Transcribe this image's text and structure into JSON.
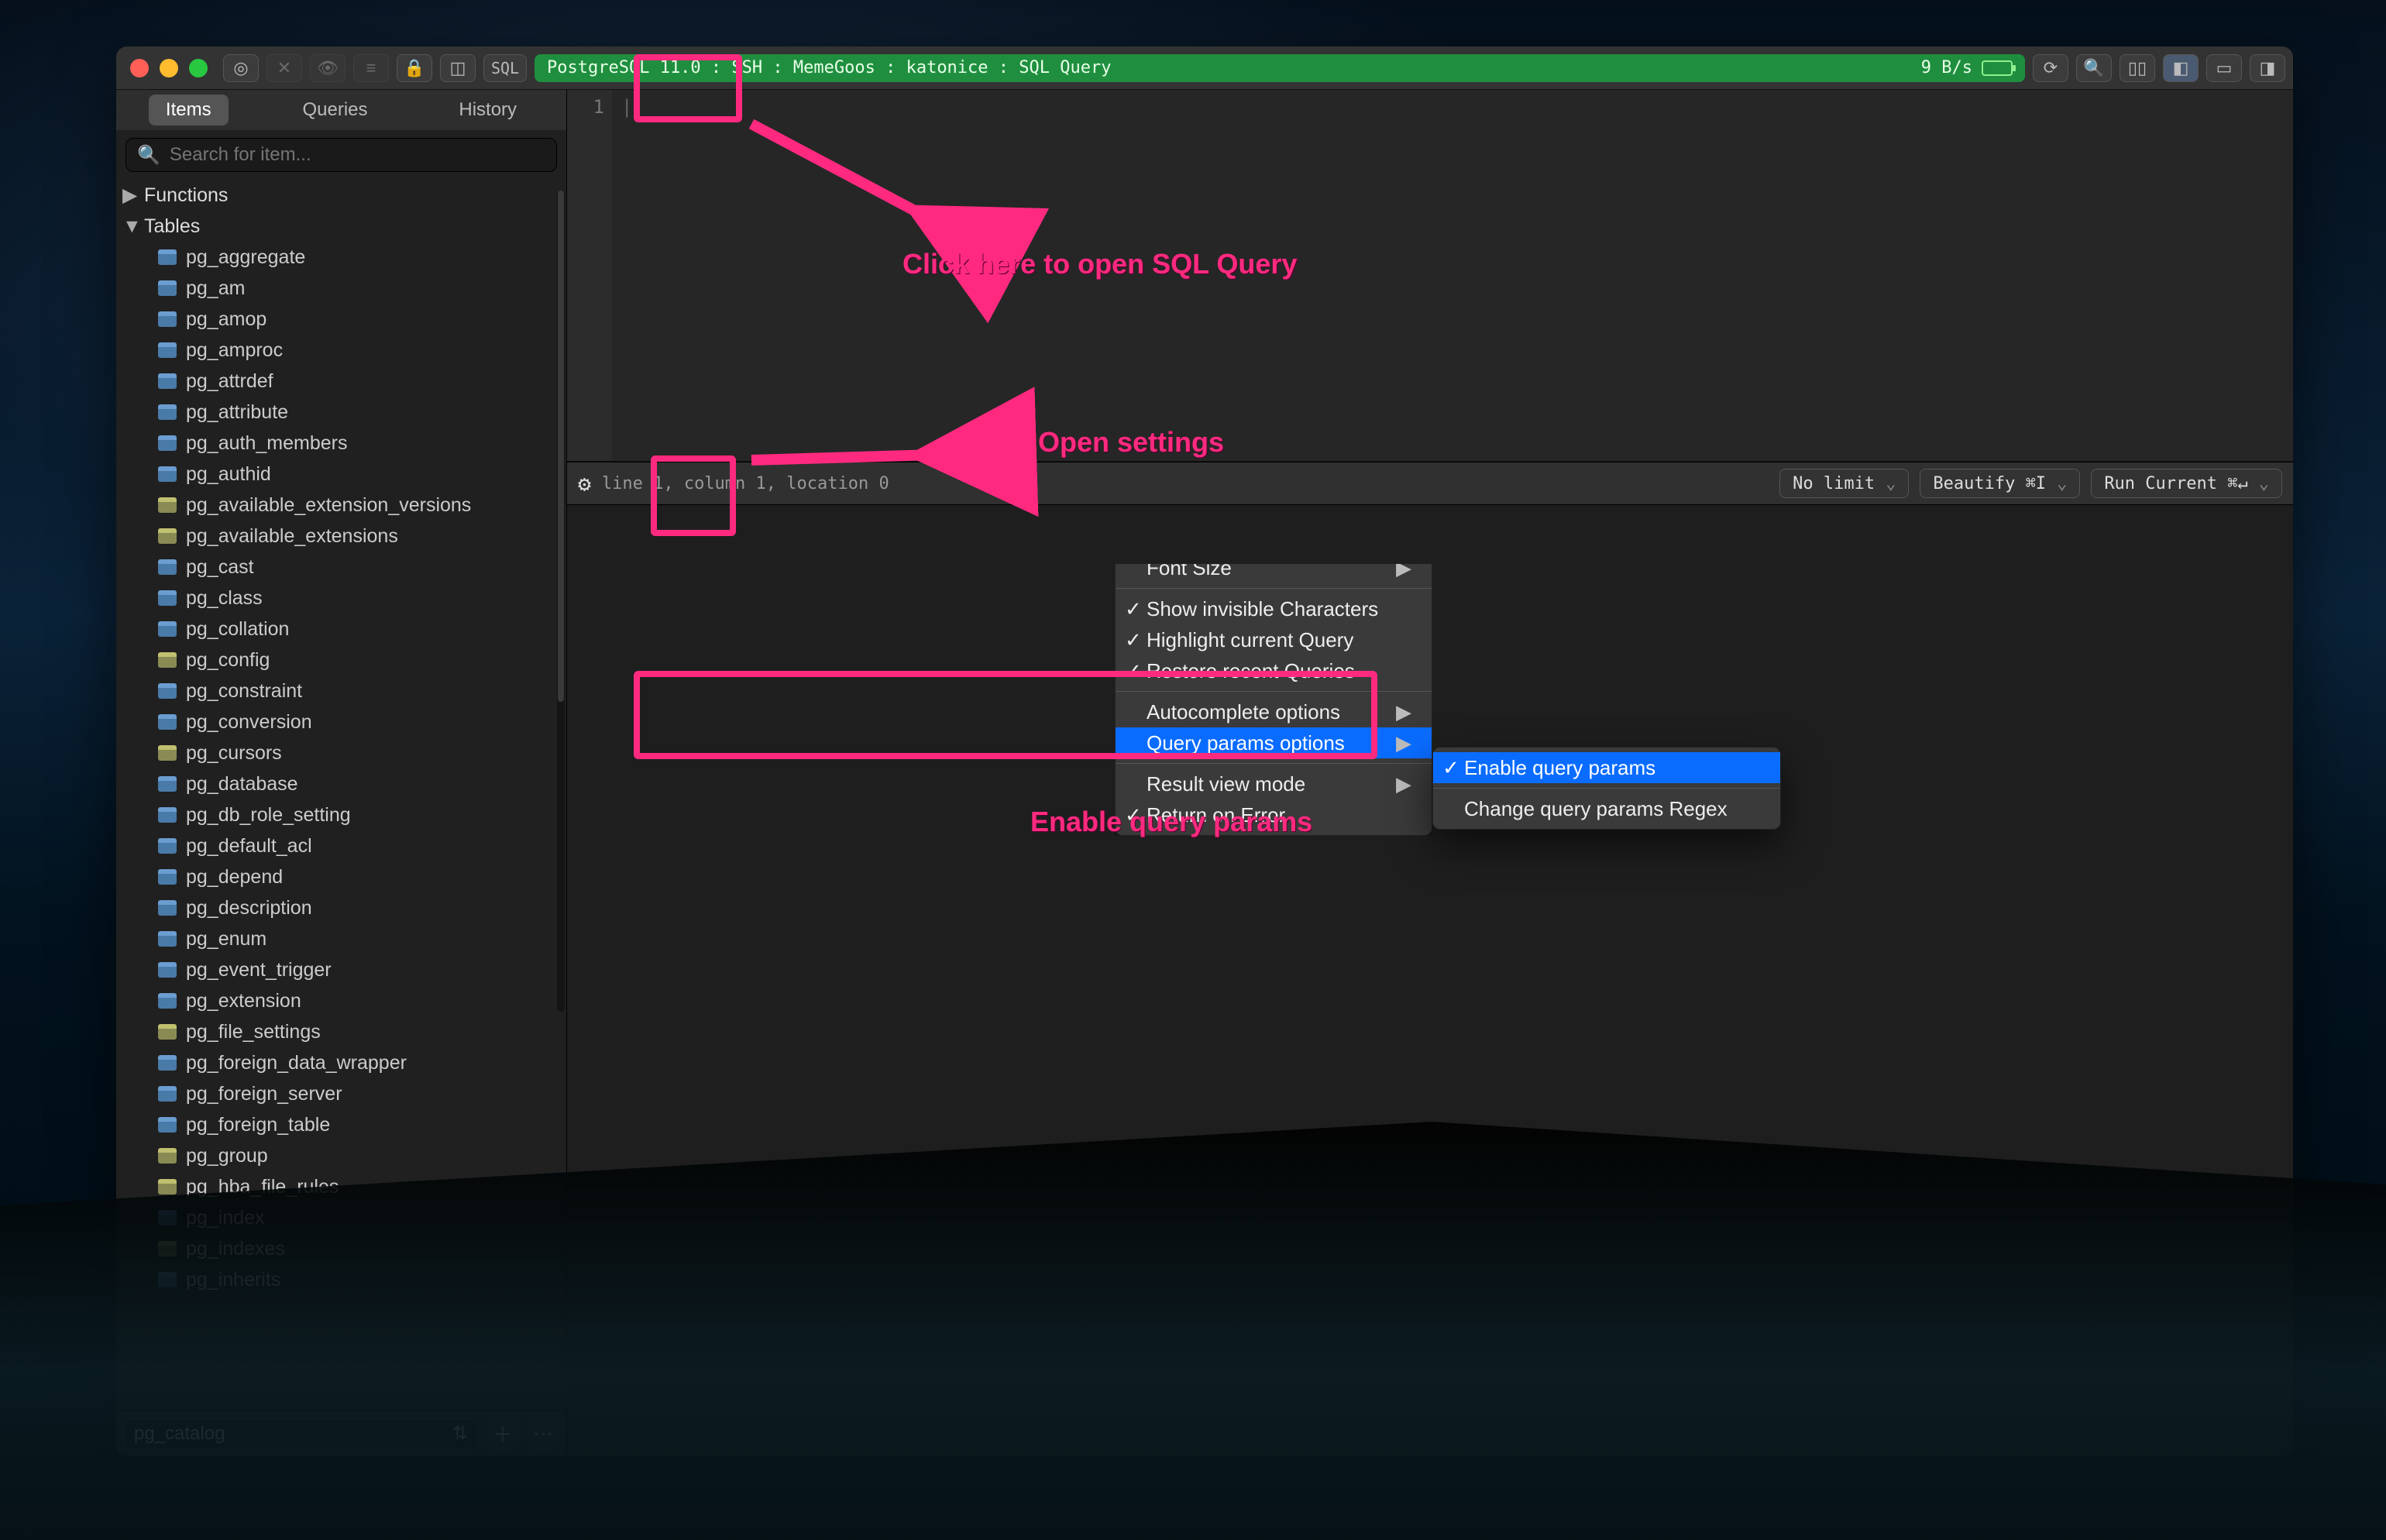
{
  "toolbar": {
    "sql_label": "SQL",
    "connection": "PostgreSQL 11.0 : SSH : MemeGoos : katonice : SQL Query",
    "rate": "9 B/s",
    "icons": {
      "nav": "target-icon",
      "eye": "eye-icon",
      "list": "list-icon",
      "lock": "lock-icon",
      "db": "database-icon",
      "refresh": "refresh-icon",
      "search": "search-icon",
      "columns": "columns-icon",
      "sidebar_left": "sidebar-left-icon",
      "sidebar_full": "sidebar-full-icon",
      "sidebar_right": "sidebar-right-icon",
      "close_x": "close-icon"
    }
  },
  "left_panel": {
    "tabs": [
      "Items",
      "Queries",
      "History"
    ],
    "active_tab": "Items",
    "search_placeholder": "Search for item...",
    "nodes": [
      {
        "label": "Functions",
        "type": "group",
        "expanded": false
      },
      {
        "label": "Tables",
        "type": "group",
        "expanded": true
      }
    ],
    "tables": [
      {
        "name": "pg_aggregate",
        "type": "table"
      },
      {
        "name": "pg_am",
        "type": "table"
      },
      {
        "name": "pg_amop",
        "type": "table"
      },
      {
        "name": "pg_amproc",
        "type": "table"
      },
      {
        "name": "pg_attrdef",
        "type": "table"
      },
      {
        "name": "pg_attribute",
        "type": "table"
      },
      {
        "name": "pg_auth_members",
        "type": "table"
      },
      {
        "name": "pg_authid",
        "type": "table"
      },
      {
        "name": "pg_available_extension_versions",
        "type": "view"
      },
      {
        "name": "pg_available_extensions",
        "type": "view"
      },
      {
        "name": "pg_cast",
        "type": "table"
      },
      {
        "name": "pg_class",
        "type": "table"
      },
      {
        "name": "pg_collation",
        "type": "table"
      },
      {
        "name": "pg_config",
        "type": "view"
      },
      {
        "name": "pg_constraint",
        "type": "table"
      },
      {
        "name": "pg_conversion",
        "type": "table"
      },
      {
        "name": "pg_cursors",
        "type": "view"
      },
      {
        "name": "pg_database",
        "type": "table"
      },
      {
        "name": "pg_db_role_setting",
        "type": "table"
      },
      {
        "name": "pg_default_acl",
        "type": "table"
      },
      {
        "name": "pg_depend",
        "type": "table"
      },
      {
        "name": "pg_description",
        "type": "table"
      },
      {
        "name": "pg_enum",
        "type": "table"
      },
      {
        "name": "pg_event_trigger",
        "type": "table"
      },
      {
        "name": "pg_extension",
        "type": "table"
      },
      {
        "name": "pg_file_settings",
        "type": "view"
      },
      {
        "name": "pg_foreign_data_wrapper",
        "type": "table"
      },
      {
        "name": "pg_foreign_server",
        "type": "table"
      },
      {
        "name": "pg_foreign_table",
        "type": "table"
      },
      {
        "name": "pg_group",
        "type": "view"
      },
      {
        "name": "pg_hba_file_rules",
        "type": "view"
      },
      {
        "name": "pg_index",
        "type": "table"
      },
      {
        "name": "pg_indexes",
        "type": "view"
      },
      {
        "name": "pg_inherits",
        "type": "table"
      }
    ],
    "schema_selected": "pg_catalog"
  },
  "editor": {
    "line_numbers": [
      "1"
    ],
    "content": "",
    "status": "line 1, column 1, location 0"
  },
  "editor_controls": {
    "limit": "No limit",
    "beautify": "Beautify ⌘I",
    "run": "Run Current ⌘↵"
  },
  "settings_menu": {
    "items": [
      {
        "label": "Font Size",
        "submenu": true
      },
      {
        "sep": true
      },
      {
        "label": "Show invisible Characters",
        "checked": true
      },
      {
        "label": "Highlight current Query",
        "checked": true
      },
      {
        "label": "Restore recent Queries",
        "checked": true
      },
      {
        "sep": true
      },
      {
        "label": "Autocomplete options",
        "submenu": true
      },
      {
        "label": "Query params options",
        "submenu": true,
        "highlighted": true
      },
      {
        "sep": true
      },
      {
        "label": "Result view mode",
        "submenu": true
      },
      {
        "label": "Return on Error",
        "checked": true
      }
    ],
    "submenu": [
      {
        "label": "Enable query params",
        "checked": true,
        "highlighted": true
      },
      {
        "sep": true
      },
      {
        "label": "Change query params Regex"
      }
    ]
  },
  "annotations": {
    "sql_arrow": "Click here to open SQL Query",
    "settings_arrow": "Open settings",
    "enable_label": "Enable query params"
  }
}
